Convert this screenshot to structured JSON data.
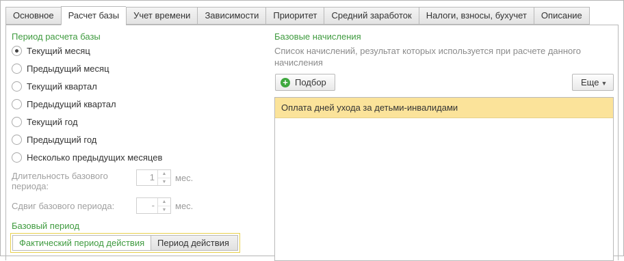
{
  "tabs": [
    {
      "label": "Основное"
    },
    {
      "label": "Расчет базы"
    },
    {
      "label": "Учет времени"
    },
    {
      "label": "Зависимости"
    },
    {
      "label": "Приоритет"
    },
    {
      "label": "Средний заработок"
    },
    {
      "label": "Налоги, взносы, бухучет"
    },
    {
      "label": "Описание"
    }
  ],
  "active_tab": "Расчет базы",
  "period": {
    "title": "Период расчета базы",
    "options": [
      {
        "label": "Текущий месяц",
        "selected": true
      },
      {
        "label": "Предыдущий месяц",
        "selected": false
      },
      {
        "label": "Текущий квартал",
        "selected": false
      },
      {
        "label": "Предыдущий квартал",
        "selected": false
      },
      {
        "label": "Текущий год",
        "selected": false
      },
      {
        "label": "Предыдущий год",
        "selected": false
      },
      {
        "label": "Несколько предыдущих месяцев",
        "selected": false
      }
    ],
    "duration_label": "Длительность базового периода:",
    "duration_value": "1",
    "duration_unit": "мес.",
    "shift_label": "Сдвиг базового периода:",
    "shift_value": "-",
    "shift_unit": "мес."
  },
  "base_period": {
    "title": "Базовый период",
    "options": [
      "Фактический период действия",
      "Период действия"
    ],
    "selected": "Фактический период действия"
  },
  "accruals": {
    "title": "Базовые начисления",
    "description": "Список начислений, результат которых используется при расчете данного начисления",
    "select_button": "Подбор",
    "more_button": "Еще",
    "items": [
      "Оплата дней ухода за детьми-инвалидами"
    ]
  },
  "colors": {
    "accent_green": "#3e9a3e",
    "selected_row": "#fbe39a",
    "highlight_border": "#e8d04a"
  }
}
